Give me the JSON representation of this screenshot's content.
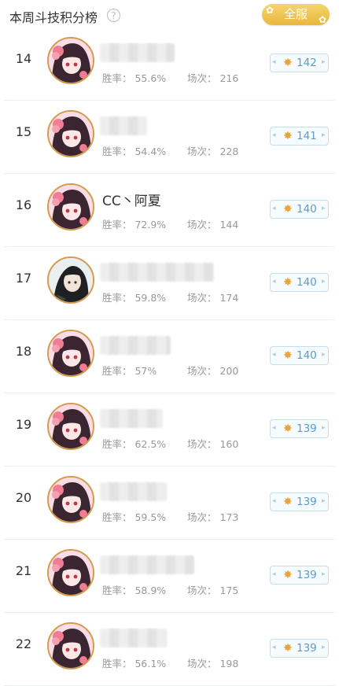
{
  "header": {
    "title": "本周斗技积分榜",
    "help_icon": "?",
    "scope_button": "全服"
  },
  "labels": {
    "winrate": "胜率：",
    "games": "场次："
  },
  "rows": [
    {
      "rank": "14",
      "name": "",
      "winrate": "55.6%",
      "games": "216",
      "score": "142",
      "avatar": "pink-hair"
    },
    {
      "rank": "15",
      "name": "",
      "winrate": "54.4%",
      "games": "228",
      "score": "141",
      "avatar": "pink-hair"
    },
    {
      "rank": "16",
      "name": "CC丶阿夏",
      "winrate": "72.9%",
      "games": "144",
      "score": "140",
      "avatar": "pink-hair"
    },
    {
      "rank": "17",
      "name": "",
      "winrate": "59.8%",
      "games": "174",
      "score": "140",
      "avatar": "dark-hair"
    },
    {
      "rank": "18",
      "name": "",
      "winrate": "57%",
      "games": "200",
      "score": "140",
      "avatar": "pink-hair"
    },
    {
      "rank": "19",
      "name": "",
      "winrate": "62.5%",
      "games": "160",
      "score": "139",
      "avatar": "pink-hair"
    },
    {
      "rank": "20",
      "name": "",
      "winrate": "59.5%",
      "games": "173",
      "score": "139",
      "avatar": "pink-hair"
    },
    {
      "rank": "21",
      "name": "",
      "winrate": "58.9%",
      "games": "175",
      "score": "139",
      "avatar": "pink-hair"
    },
    {
      "rank": "22",
      "name": "",
      "winrate": "56.1%",
      "games": "198",
      "score": "139",
      "avatar": "pink-hair"
    }
  ],
  "colors": {
    "accent_gold": "#e8b73d",
    "score_text": "#5a9ccc",
    "avatar_border": "#d59a4b"
  }
}
